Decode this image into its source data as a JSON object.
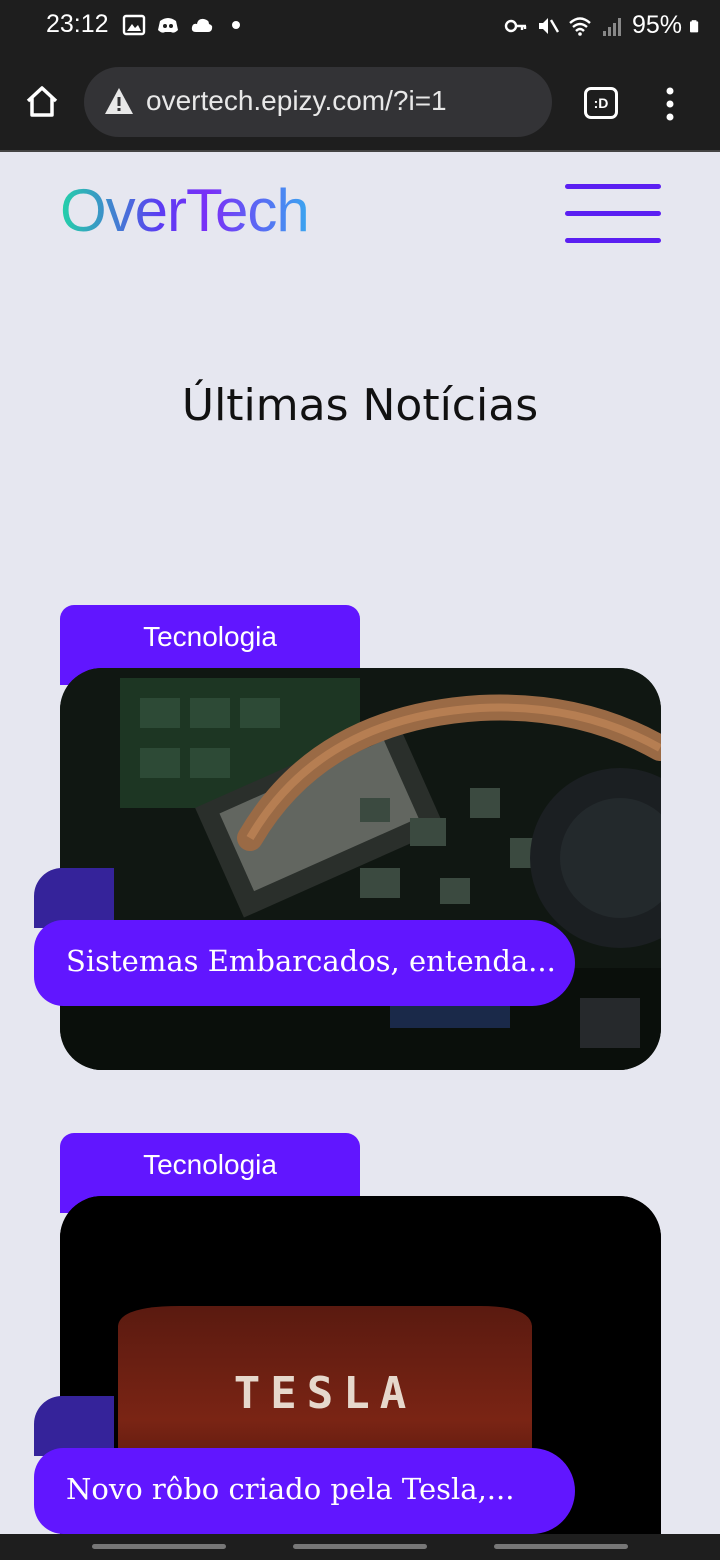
{
  "status_bar": {
    "time": "23:12",
    "battery": "95%",
    "left_icons": [
      "image-icon",
      "discord-icon",
      "cloud-icon",
      "dot-icon"
    ],
    "right_icons": [
      "key-icon",
      "mute-icon",
      "wifi-icon",
      "signal-icon",
      "battery-icon"
    ]
  },
  "browser": {
    "url": "overtech.epizy.com/?i=1",
    "tabs_label": ":D"
  },
  "site": {
    "logo": "OverTech",
    "page_title": "Últimas Notícias"
  },
  "articles": [
    {
      "category": "Tecnologia",
      "title": "Sistemas Embarcados, entenda...",
      "image": "circuit-board-photo"
    },
    {
      "category": "Tecnologia",
      "title": "Novo rôbo criado pela Tesla,...",
      "image": "tesla-logo-photo",
      "image_text": "TESLA"
    }
  ],
  "colors": {
    "accent": "#6116ff",
    "background": "#e6e7f0",
    "chrome": "#1e1e1e"
  }
}
